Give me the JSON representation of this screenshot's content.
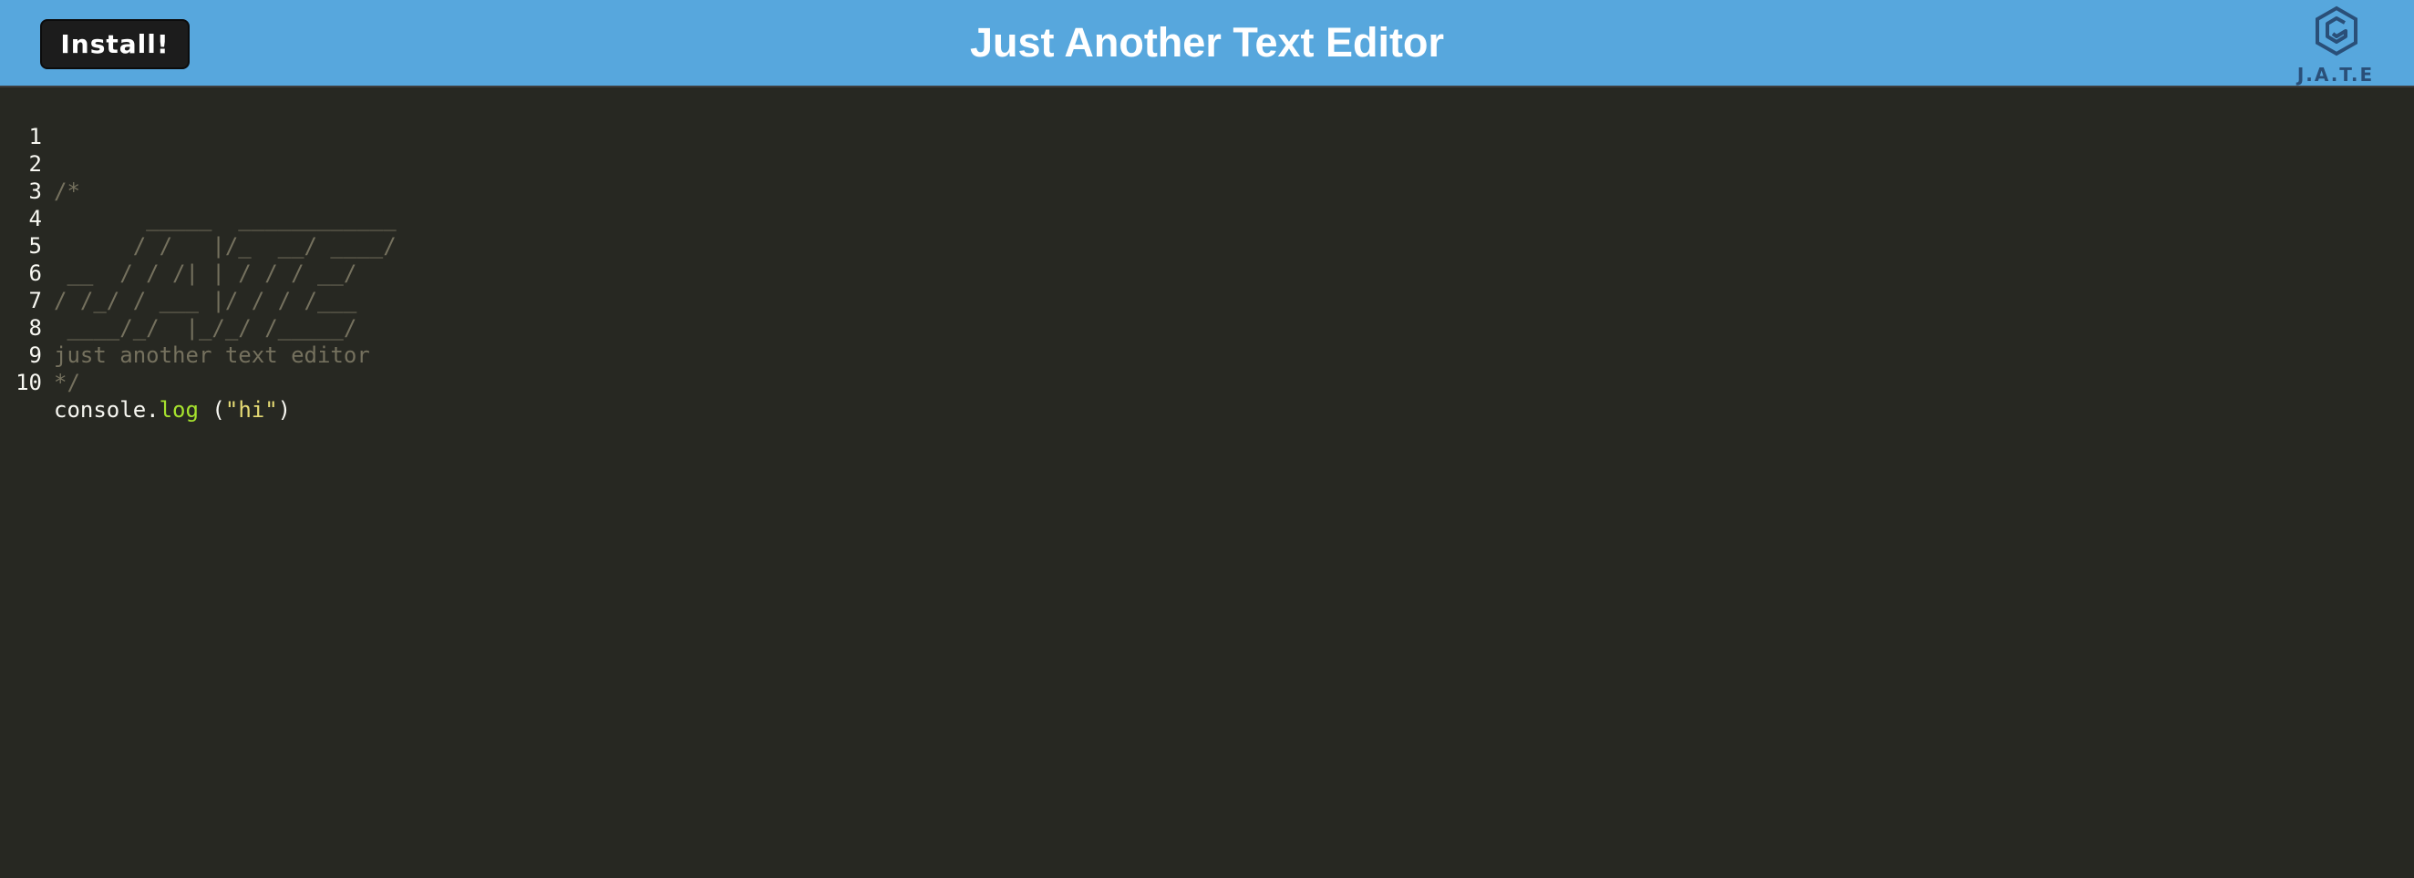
{
  "header": {
    "install_label": "Install!",
    "title": "Just Another Text Editor",
    "logo_text": "J.A.T.E"
  },
  "colors": {
    "header_bg": "#57a7dd",
    "editor_bg": "#272822",
    "comment": "#75715e",
    "property": "#a6e22e",
    "string": "#e6db74",
    "text": "#f8f8f2"
  },
  "editor": {
    "lines": [
      {
        "number": "1",
        "text": ""
      },
      {
        "number": "2",
        "text": "/*"
      },
      {
        "number": "3",
        "text": "       _____  ____________"
      },
      {
        "number": "4",
        "text": "      / /   |/_  __/ ____/"
      },
      {
        "number": "5",
        "text": " __  / / /| | / / / __/"
      },
      {
        "number": "6",
        "text": "/ /_/ / ___ |/ / / /___"
      },
      {
        "number": "7",
        "text": " ____/_/  |_/_/ /_____/"
      },
      {
        "number": "8",
        "text": "just another text editor"
      },
      {
        "number": "9",
        "text": "*/"
      },
      {
        "number": "10",
        "obj": "console",
        "dot": ".",
        "method": "log",
        "space_paren": " (",
        "arg": "\"hi\"",
        "close": ")"
      }
    ]
  }
}
